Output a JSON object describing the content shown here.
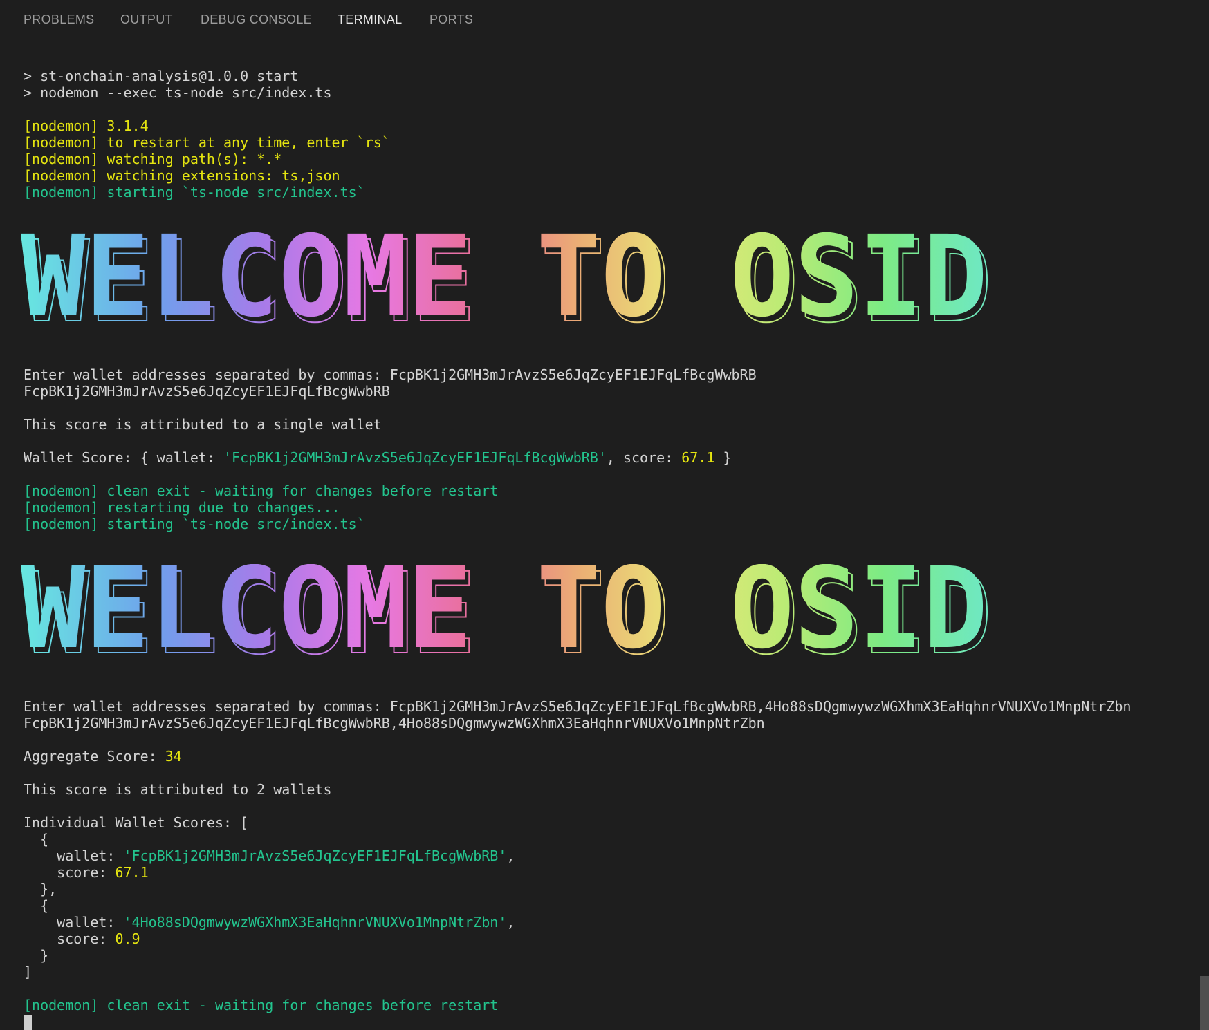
{
  "tabs": [
    {
      "label": "PROBLEMS",
      "active": false
    },
    {
      "label": "OUTPUT",
      "active": false
    },
    {
      "label": "DEBUG CONSOLE",
      "active": false
    },
    {
      "label": "TERMINAL",
      "active": true
    },
    {
      "label": "PORTS",
      "active": false
    }
  ],
  "colors": {
    "background": "#1e1e1e",
    "text": "#d4d4d4",
    "yellow": "#e5e510",
    "green": "#23c48e",
    "banner_gradient": [
      "#67e8e0",
      "#6fa0ec",
      "#a77be9",
      "#e779e4",
      "#ea6e8f",
      "#ebb074",
      "#e9e779",
      "#bbeb75",
      "#7deb84",
      "#6ee8c4"
    ]
  },
  "terminal": {
    "run": {
      "pkg_line": "> st-onchain-analysis@1.0.0 start",
      "cmd_line": "> nodemon --exec ts-node src/index.ts"
    },
    "nodemon1": {
      "version": "[nodemon] 3.1.4",
      "restart_hint": "[nodemon] to restart at any time, enter `rs`",
      "watch_paths": "[nodemon] watching path(s): *.*",
      "watch_ext": "[nodemon] watching extensions: ts,json",
      "starting": "[nodemon] starting `ts-node src/index.ts`"
    },
    "banner_text": "WELCOME TO OSID",
    "session1": {
      "prompt": "Enter wallet addresses separated by commas: FcpBK1j2GMH3mJrAvzS5e6JqZcyEF1EJFqLfBcgWwbRB",
      "echo": "FcpBK1j2GMH3mJrAvzS5e6JqZcyEF1EJFqLfBcgWwbRB",
      "attribution": "This score is attributed to a single wallet",
      "score_prefix": "Wallet Score: { wallet: ",
      "score_wallet": "'FcpBK1j2GMH3mJrAvzS5e6JqZcyEF1EJFqLfBcgWwbRB'",
      "score_mid": ", score: ",
      "score_value": "67.1",
      "score_suffix": " }"
    },
    "nodemon2": {
      "clean_exit": "[nodemon] clean exit - waiting for changes before restart",
      "restarting": "[nodemon] restarting due to changes...",
      "starting": "[nodemon] starting `ts-node src/index.ts`"
    },
    "session2": {
      "prompt": "Enter wallet addresses separated by commas: FcpBK1j2GMH3mJrAvzS5e6JqZcyEF1EJFqLfBcgWwbRB,4Ho88sDQgmwywzWGXhmX3EaHqhnrVNUXVo1MnpNtrZbn",
      "echo": "FcpBK1j2GMH3mJrAvzS5e6JqZcyEF1EJFqLfBcgWwbRB,4Ho88sDQgmwywzWGXhmX3EaHqhnrVNUXVo1MnpNtrZbn",
      "aggregate_label": "Aggregate Score: ",
      "aggregate_value": "34",
      "attribution": "This score is attributed to 2 wallets",
      "individual_header": "Individual Wallet Scores: [",
      "open_brace_1": "  {",
      "w1_label": "    wallet: ",
      "w1_value": "'FcpBK1j2GMH3mJrAvzS5e6JqZcyEF1EJFqLfBcgWwbRB'",
      "w1_comma": ",",
      "s1_label": "    score: ",
      "s1_value": "67.1",
      "close_brace_1": "  },",
      "open_brace_2": "  {",
      "w2_label": "    wallet: ",
      "w2_value": "'4Ho88sDQgmwywzWGXhmX3EaHqhnrVNUXVo1MnpNtrZbn'",
      "w2_comma": ",",
      "s2_label": "    score: ",
      "s2_value": "0.9",
      "close_brace_2": "  }",
      "close_bracket": "]"
    },
    "nodemon3": {
      "clean_exit": "[nodemon] clean exit - waiting for changes before restart"
    }
  }
}
